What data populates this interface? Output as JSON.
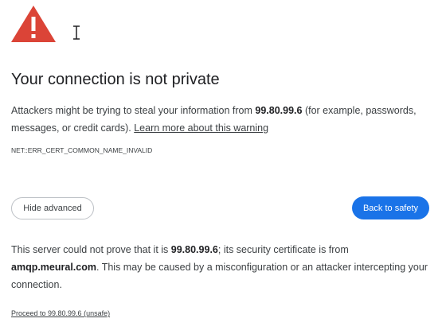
{
  "interstitial": {
    "warning_icon": "warning-triangle-icon",
    "cursor_icon": "text-cursor-icon",
    "title": "Your connection is not private",
    "description": {
      "before": "Attackers might be trying to steal your information from ",
      "host": "99.80.99.6",
      "after": " (for example, passwords, messages, or credit cards). ",
      "learn_more": "Learn more about this warning"
    },
    "error_code": "NET::ERR_CERT_COMMON_NAME_INVALID",
    "hide_advanced_label": "Hide advanced",
    "back_to_safety_label": "Back to safety",
    "details": {
      "part1": "This server could not prove that it is ",
      "host": "99.80.99.6",
      "part2": "; its security certificate is from ",
      "cert_domain": "amqp.meural.com",
      "part3": ". This may be caused by a misconfiguration or an attacker intercepting your connection."
    },
    "proceed_link": "Proceed to 99.80.99.6 (unsafe)"
  },
  "colors": {
    "warning_red": "#db4437",
    "primary_blue": "#1a73e8",
    "text": "#202124",
    "secondary_text": "#3c4043",
    "button_border": "#bdc1c6"
  }
}
